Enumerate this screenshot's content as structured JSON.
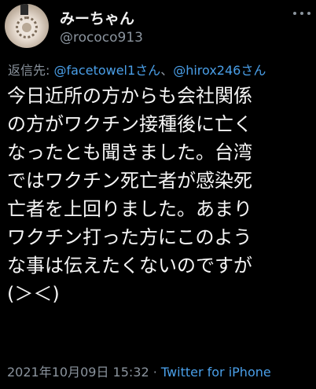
{
  "tweet": {
    "display_name": "みーちゃん",
    "handle": "@rococo913",
    "reply": {
      "prefix": "返信先: ",
      "mention_1": "@facetowel1さん",
      "separator": "、",
      "mention_2": "@hirox246さん"
    },
    "body_lines": [
      "今日近所の方からも会社関係",
      "の方がワクチン接種後に亡く",
      "なったとも聞きました。台湾",
      "ではワクチン死亡者が感染死",
      "亡者を上回りました。あまり",
      "ワクチン打った方にこのよう",
      "な事は伝えたくないのですが",
      "(＞＜)"
    ],
    "timestamp": "2021年10月09日 15:32",
    "dot": " · ",
    "source": "Twitter for iPhone"
  },
  "icons": {
    "avatar": "avatar-image",
    "more": "more-options-icon"
  },
  "colors": {
    "background": "#000000",
    "text": "#f5f5f5",
    "secondary": "#8b949e",
    "link": "#4a9fe8"
  }
}
